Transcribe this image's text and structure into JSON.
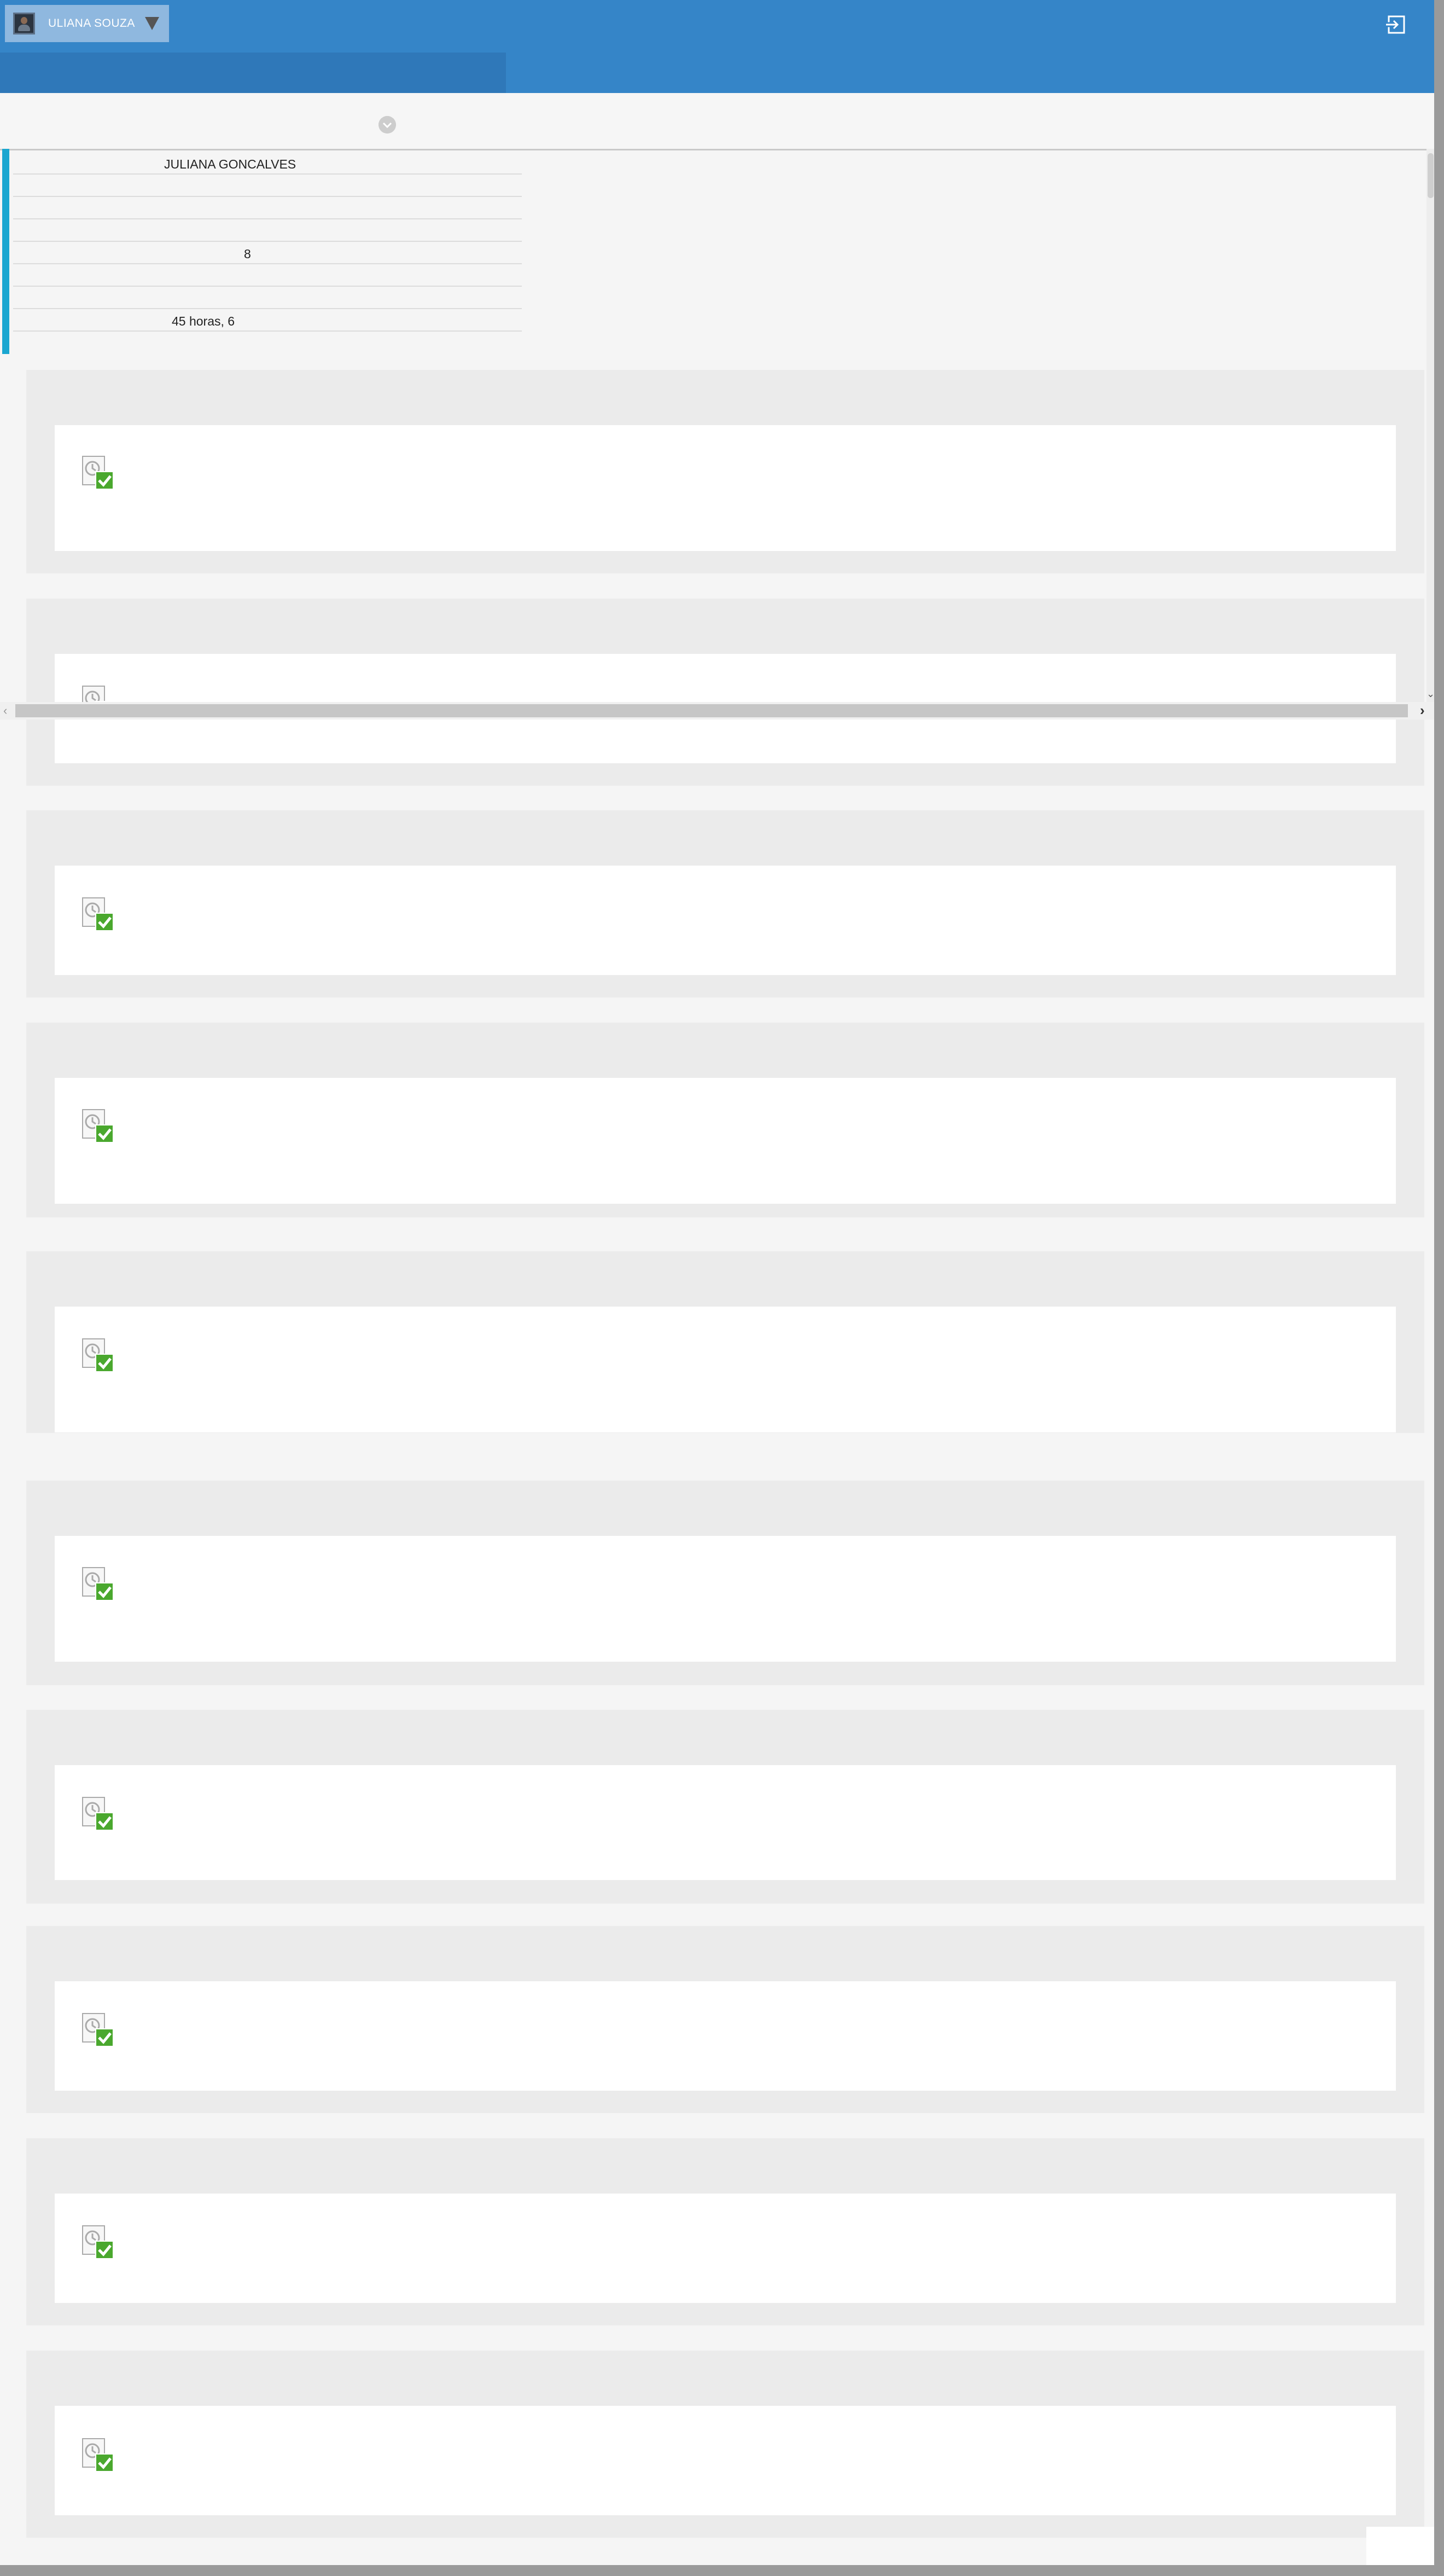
{
  "header": {
    "user_name": "ULIANA SOUZA",
    "user_menu_icon": "chevron-down-icon",
    "logout_icon": "logout-icon",
    "avatar_icon": "avatar"
  },
  "toolbar": {
    "expand_icon": "chevron-down-circle-icon"
  },
  "info_panel": {
    "rows": [
      "JULIANA GONCALVES",
      "",
      "",
      "",
      "8",
      "",
      "",
      "45 horas, 6"
    ]
  },
  "cards": [
    {
      "icon": "document-check-icon"
    },
    {
      "icon": "document-check-icon"
    },
    {
      "icon": "document-check-icon"
    },
    {
      "icon": "document-check-icon"
    },
    {
      "icon": "document-check-icon"
    },
    {
      "icon": "document-check-icon"
    },
    {
      "icon": "document-check-icon"
    },
    {
      "icon": "document-check-icon"
    },
    {
      "icon": "document-check-icon"
    },
    {
      "icon": "document-check-icon"
    }
  ],
  "colors": {
    "header_bg": "#3585c8",
    "subnav_bg": "#2f78b9",
    "accent": "#1aa6d0",
    "check_green": "#4aa82e"
  }
}
